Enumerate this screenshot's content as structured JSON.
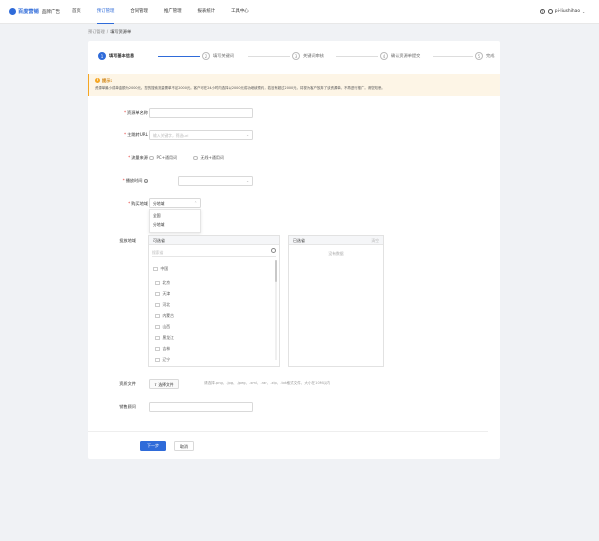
{
  "header": {
    "brand": "百度营销",
    "brand_sub": "品牌广告",
    "nav": [
      "首页",
      "预订管理",
      "合同管理",
      "推广管理",
      "报表统计",
      "工具中心"
    ],
    "active_nav_index": 1,
    "user": "pi-liushihao"
  },
  "breadcrumb": {
    "parent": "预订管理",
    "separator": "/",
    "current": "填写资源单"
  },
  "steps": [
    {
      "num": "1",
      "label": "填写基本信息"
    },
    {
      "num": "2",
      "label": "填写关键词"
    },
    {
      "num": "3",
      "label": "关键词审核"
    },
    {
      "num": "4",
      "label": "确认资源单提交"
    },
    {
      "num": "5",
      "label": "完成"
    }
  ],
  "notice": {
    "title": "提示:",
    "body": "资源单最小成单金额为2000元。您的搜索流量需单不足2000元。客户可在24小时内选择以2000元成功继续预约，若没有超过2000元，将视为客户放弃了该资源单。不再进行推广。请您知悉。"
  },
  "form": {
    "resource_name_label": "资源单名称",
    "landing_url_label": "主跳转URL",
    "landing_url_placeholder": "输入关键字，筛选url",
    "traffic_label": "流量来源",
    "traffic_opt1": "PC+通用词",
    "traffic_opt2": "无线+通用词",
    "period_label": "播放时间",
    "period_help": "?",
    "region_label": "购买地域",
    "region_value": "分地域",
    "region_options": [
      "全国",
      "分地域"
    ],
    "local_region_label": "投放地域",
    "upload_label": "资质文件",
    "upload_btn": "选择文件",
    "upload_hint": "请选择.png、.jpg、.jpeg、.xml、.rar、.zip、.txt格式文件，大小在10M以内",
    "sales_label": "销售顾问"
  },
  "transfer": {
    "left_title": "可选省",
    "search_placeholder": "搜索省",
    "root": "中国",
    "items": [
      "北京",
      "天津",
      "河北",
      "内蒙古",
      "山西",
      "黑龙江",
      "吉林",
      "辽宁"
    ],
    "right_title": "已选省",
    "clear": "清空",
    "empty": "没有数据"
  },
  "buttons": {
    "next": "下一步",
    "cancel": "取消"
  },
  "colors": {
    "primary": "#2f6bd9",
    "warning": "#f5a623",
    "required": "#e53935"
  }
}
